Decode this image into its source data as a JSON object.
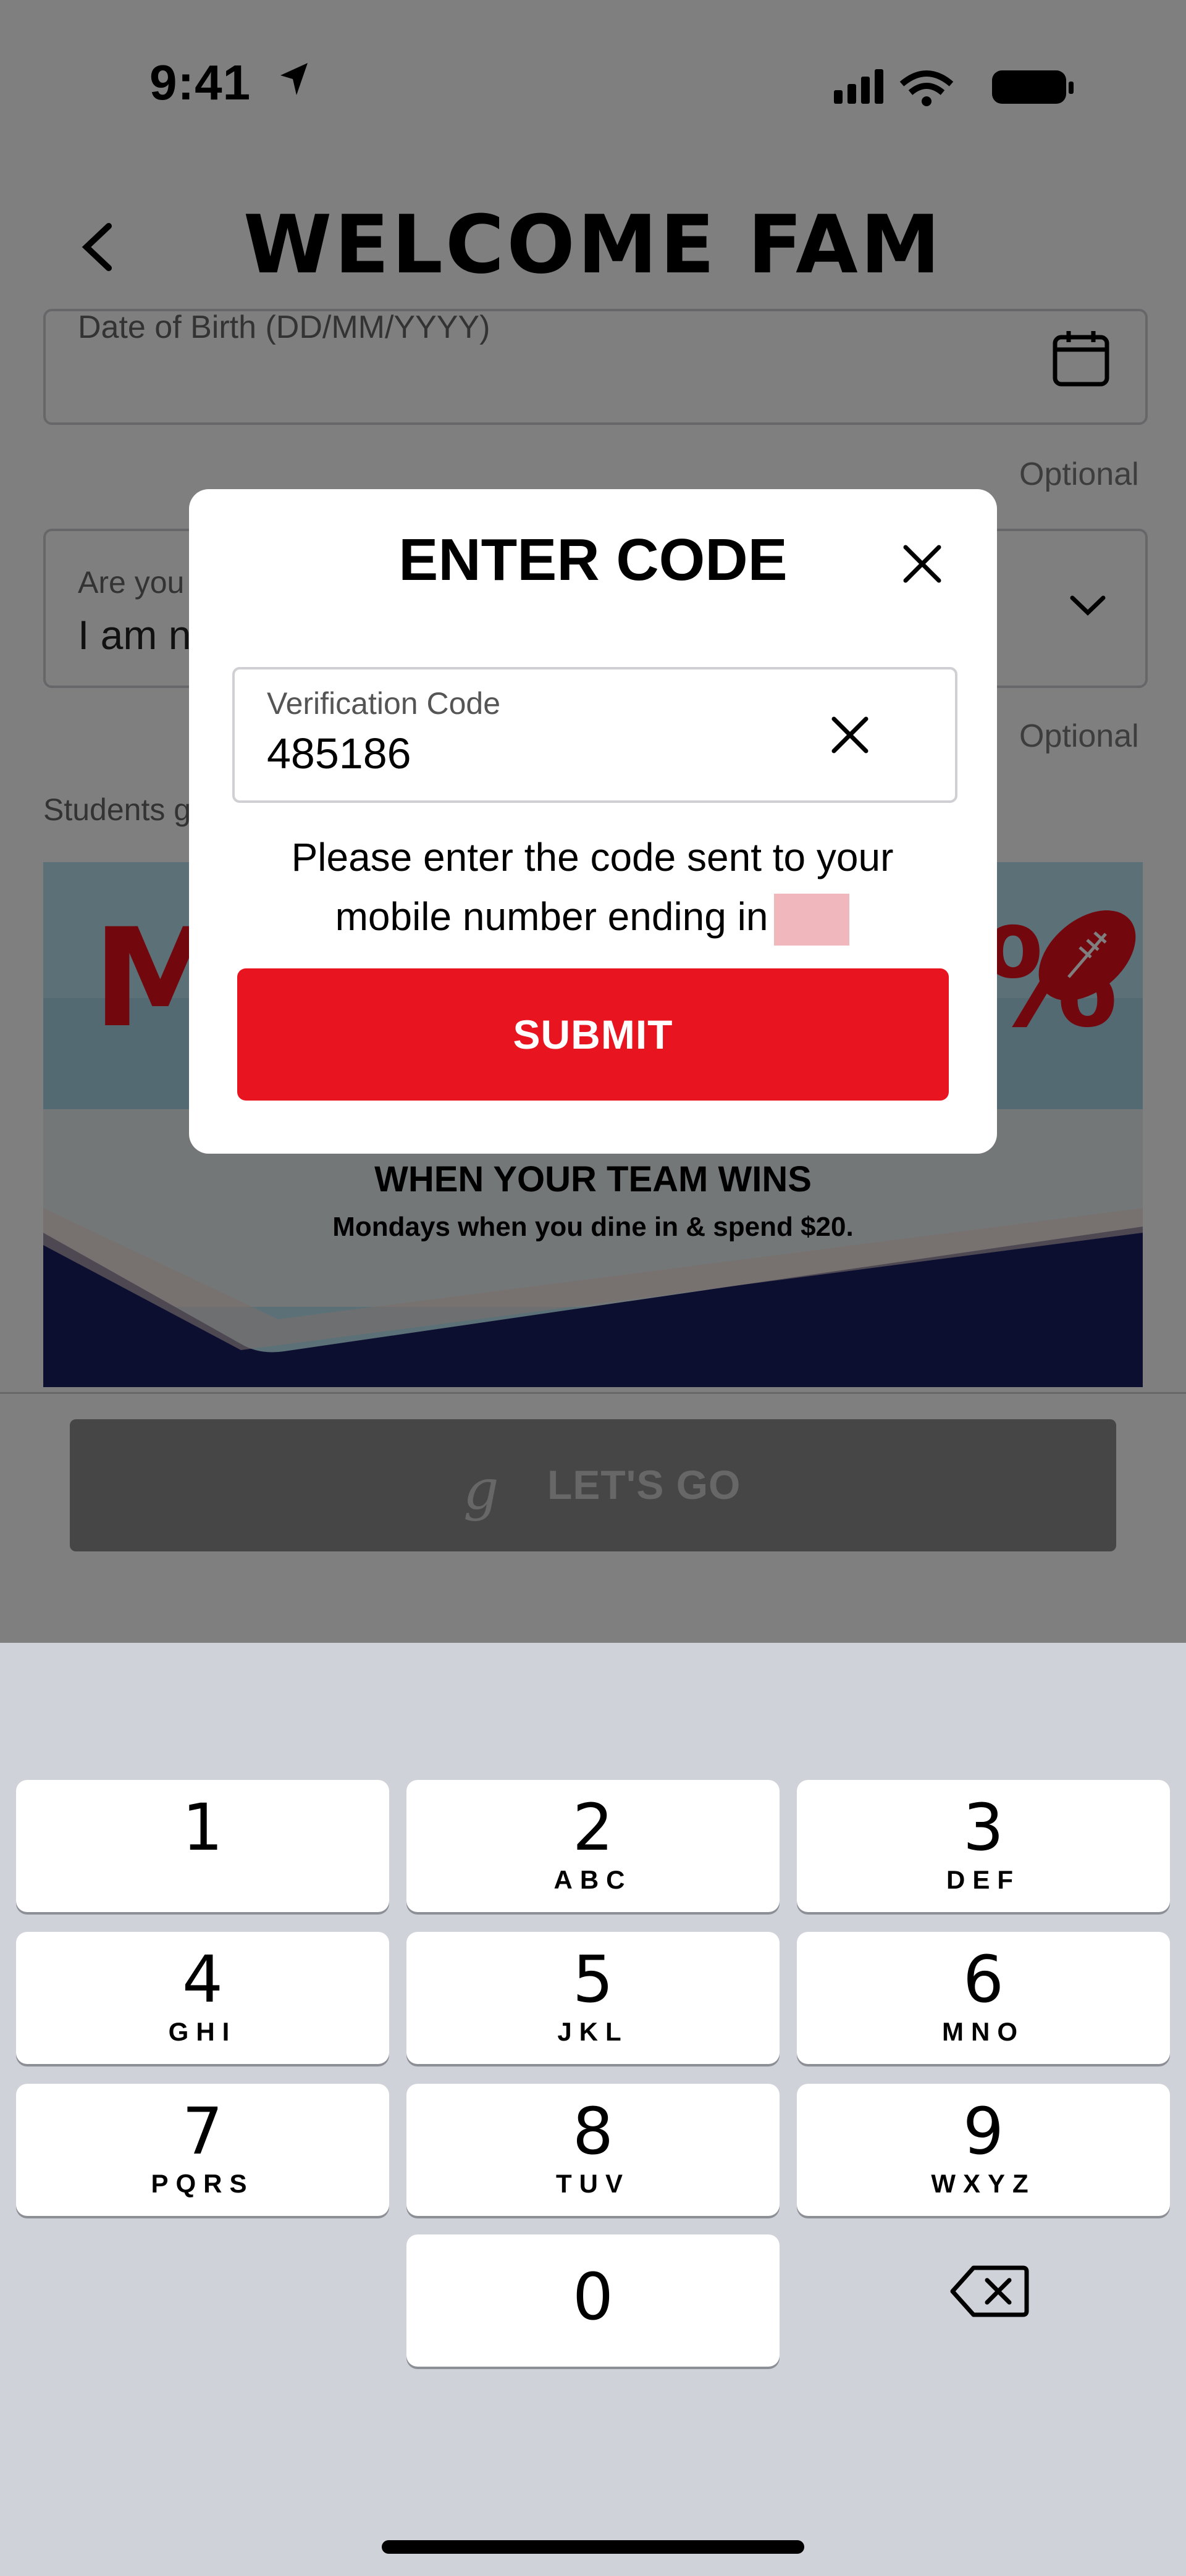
{
  "status_bar": {
    "time": "9:41"
  },
  "header": {
    "title": "WELCOME FAM"
  },
  "form": {
    "dob_label": "Date of Birth (DD/MM/YYYY)",
    "optional_1": "Optional",
    "are_you_label": "Are you",
    "are_you_value": "I am n",
    "optional_2": "Optional",
    "students_text": "Students g"
  },
  "promo": {
    "headline": "WHEN YOUR TEAM WINS",
    "subline": "Mondays when you dine in & spend $20.",
    "big_letter": "M",
    "big_symbol": "%"
  },
  "lets_go": {
    "icon_glyph": "g",
    "label": "LET'S GO"
  },
  "modal": {
    "title": "ENTER CODE",
    "code_label": "Verification Code",
    "code_value": "485186",
    "instruction_line1": "Please enter the code sent to your",
    "instruction_line2": "mobile number ending in",
    "submit_label": "SUBMIT"
  },
  "keyboard": {
    "keys": [
      {
        "num": "1",
        "letters": ""
      },
      {
        "num": "2",
        "letters": "ABC"
      },
      {
        "num": "3",
        "letters": "DEF"
      },
      {
        "num": "4",
        "letters": "GHI"
      },
      {
        "num": "5",
        "letters": "JKL"
      },
      {
        "num": "6",
        "letters": "MNO"
      },
      {
        "num": "7",
        "letters": "PQRS"
      },
      {
        "num": "8",
        "letters": "TUV"
      },
      {
        "num": "9",
        "letters": "WXYZ"
      },
      {
        "num": "0",
        "letters": ""
      }
    ]
  },
  "colors": {
    "accent_red": "#e8141f",
    "promo_navy": "#1a1f63"
  }
}
